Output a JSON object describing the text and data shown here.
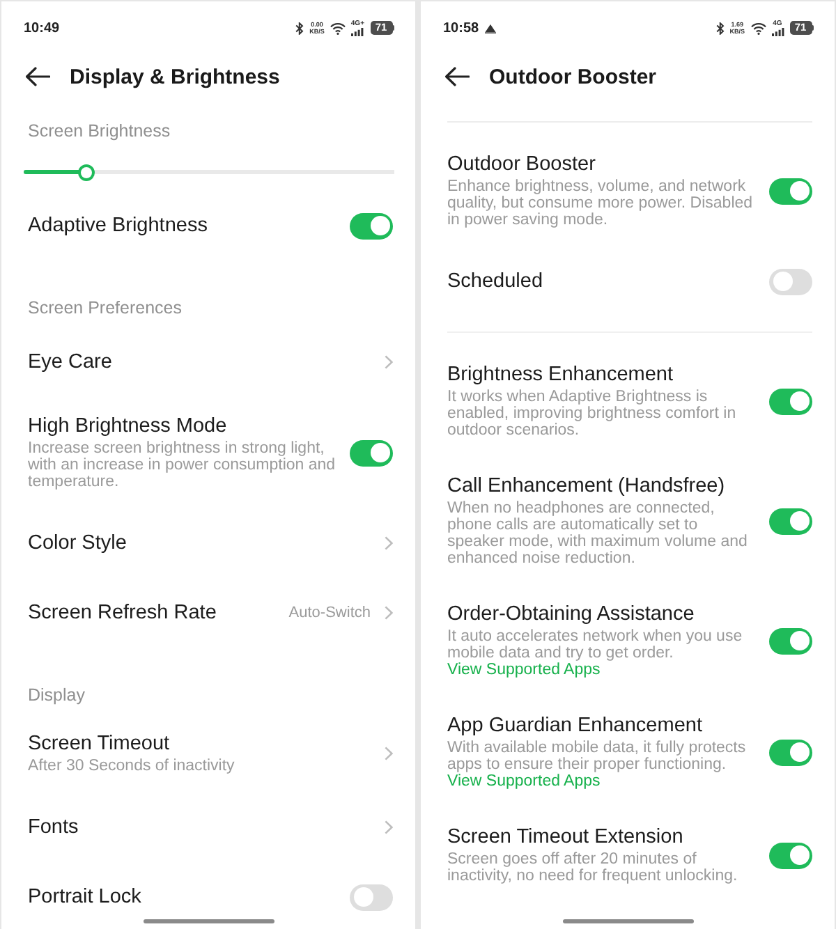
{
  "screens": [
    {
      "status_bar": {
        "time": "10:49",
        "speed": "0.00",
        "speed_unit": "KB/S",
        "network": "4G+",
        "battery": "71"
      },
      "header": {
        "title": "Display & Brightness"
      },
      "sections": [
        {
          "title": "Screen Brightness",
          "items": [
            {
              "kind": "slider",
              "level": 0.17
            },
            {
              "kind": "toggle",
              "label": "Adaptive Brightness",
              "on": true
            }
          ]
        },
        {
          "title": "Screen Preferences",
          "items": [
            {
              "kind": "nav",
              "label": "Eye Care"
            },
            {
              "kind": "toggle",
              "label": "High Brightness Mode",
              "description": "Increase screen brightness in strong light, with an increase in power consumption and temperature.",
              "on": true
            },
            {
              "kind": "nav",
              "label": "Color Style"
            },
            {
              "kind": "nav",
              "label": "Screen Refresh Rate",
              "value": "Auto-Switch"
            }
          ]
        },
        {
          "title": "Display",
          "items": [
            {
              "kind": "nav",
              "label": "Screen Timeout",
              "description": "After 30 Seconds of inactivity"
            },
            {
              "kind": "nav",
              "label": "Fonts"
            },
            {
              "kind": "toggle",
              "label": "Portrait Lock",
              "on": false
            }
          ]
        }
      ]
    },
    {
      "status_bar": {
        "time": "10:58",
        "notification_icons": [
          {
            "kind": "booster"
          }
        ],
        "speed": "1.69",
        "speed_unit": "KB/S",
        "network": "4G",
        "battery": "71"
      },
      "header": {
        "title": "Outdoor Booster",
        "divider": true
      },
      "sections": [
        {
          "items": [
            {
              "kind": "toggle",
              "label": "Outdoor Booster",
              "description": "Enhance brightness, volume, and network quality, but consume more power. Disabled in power saving mode.",
              "on": true
            },
            {
              "kind": "toggle",
              "label": "Scheduled",
              "on": false
            }
          ]
        },
        {
          "items": [
            {
              "kind": "toggle",
              "label": "Brightness Enhancement",
              "description": "It works when Adaptive Brightness is enabled, improving brightness comfort in outdoor scenarios.",
              "on": true
            },
            {
              "kind": "toggle",
              "label": "Call Enhancement (Handsfree)",
              "description": "When no headphones are connected, phone calls are automatically set to speaker mode, with maximum volume and enhanced noise reduction.",
              "on": true
            },
            {
              "kind": "toggle",
              "label": "Order-Obtaining Assistance",
              "description": "It auto accelerates network when you use mobile data and try to get order.",
              "link": "View Supported Apps",
              "on": true
            },
            {
              "kind": "toggle",
              "label": "App Guardian Enhancement",
              "description": "With available mobile data, it fully protects apps to ensure their proper functioning.",
              "link": "View Supported Apps",
              "on": true
            },
            {
              "kind": "toggle",
              "label": "Screen Timeout Extension",
              "description": "Screen goes off after 20 minutes of inactivity, no need for frequent unlocking.",
              "on": true
            }
          ]
        }
      ]
    }
  ]
}
